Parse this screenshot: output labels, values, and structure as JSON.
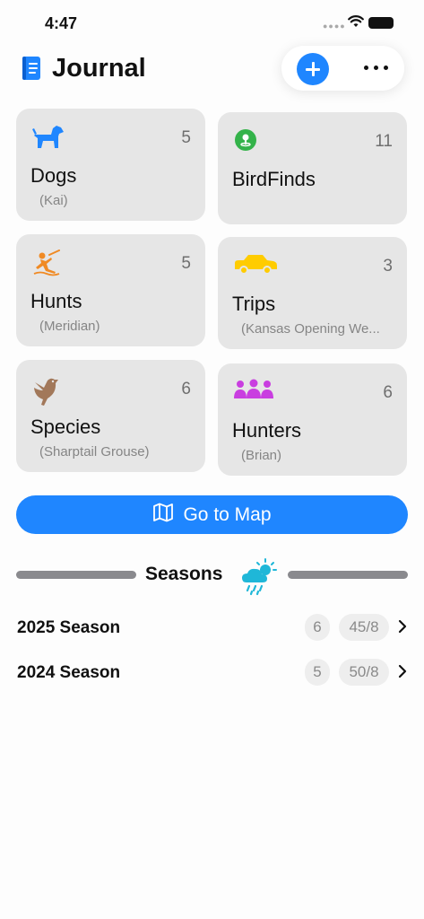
{
  "status": {
    "time": "4:47"
  },
  "header": {
    "title": "Journal"
  },
  "cards": [
    {
      "title": "Dogs",
      "subtitle": "(Kai)",
      "count": "5",
      "icon": "dog-icon",
      "color": "#1f86ff"
    },
    {
      "title": "BirdFinds",
      "subtitle": "",
      "count": "11",
      "icon": "location-pin-icon",
      "color": "#34b34a"
    },
    {
      "title": "Hunts",
      "subtitle": "(Meridian)",
      "count": "5",
      "icon": "hunter-icon",
      "color": "#f08a24"
    },
    {
      "title": "Trips",
      "subtitle": "(Kansas Opening We...",
      "count": "3",
      "icon": "car-icon",
      "color": "#ffcc00"
    },
    {
      "title": "Species",
      "subtitle": "(Sharptail Grouse)",
      "count": "6",
      "icon": "bird-icon",
      "color": "#a2785a"
    },
    {
      "title": "Hunters",
      "subtitle": "(Brian)",
      "count": "6",
      "icon": "people-icon",
      "color": "#c93ee0"
    }
  ],
  "map_button": {
    "label": "Go to Map"
  },
  "seasons": {
    "title": "Seasons",
    "rows": [
      {
        "label": "2025 Season",
        "count": "6",
        "ratio": "45/8"
      },
      {
        "label": "2024 Season",
        "count": "5",
        "ratio": "50/8"
      }
    ]
  },
  "colors": {
    "accent": "#1f86ff",
    "card_bg": "#e6e6e6",
    "weather_icon": "#1fb7d8"
  }
}
